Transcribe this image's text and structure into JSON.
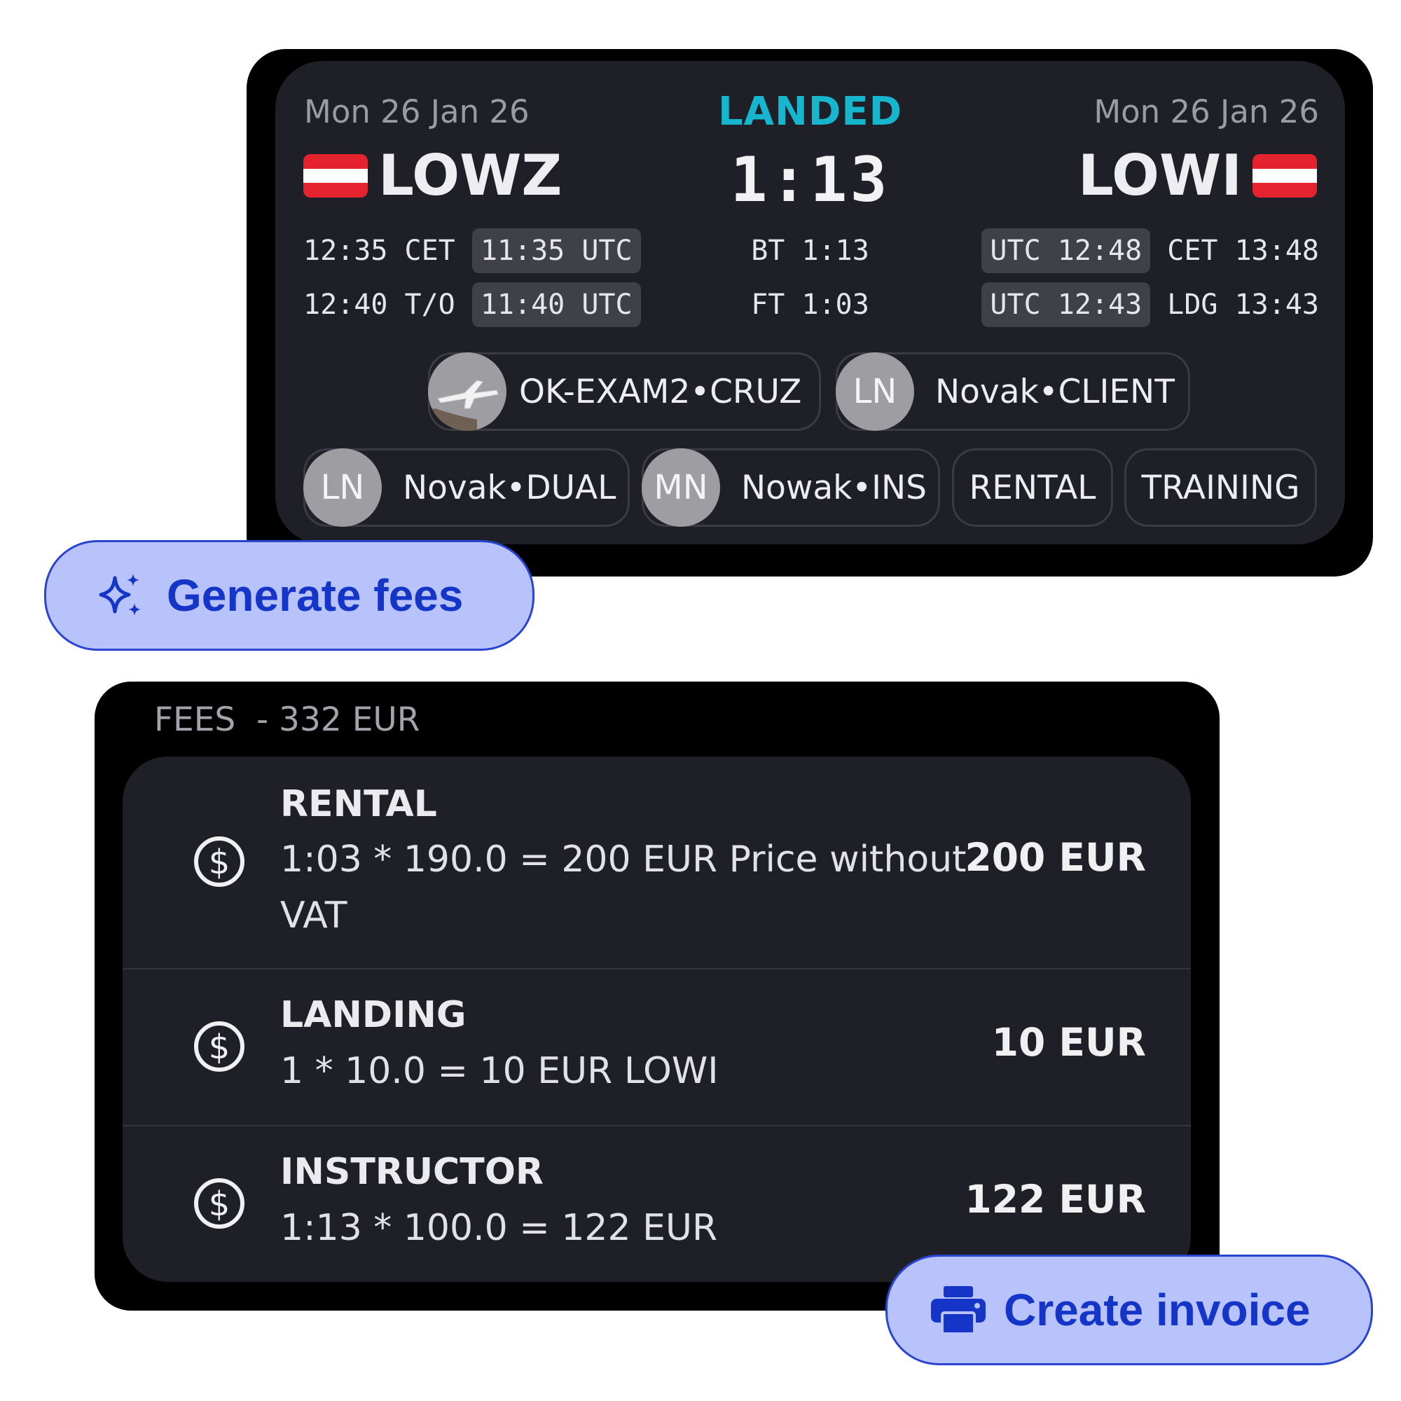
{
  "flight": {
    "departure": {
      "date": "Mon 26 Jan 26",
      "code": "LOWZ",
      "local_time": "12:35 CET",
      "utc_time": "11:35 UTC",
      "takeoff_local": "12:40 T/O",
      "takeoff_utc": "11:40 UTC"
    },
    "arrival": {
      "date": "Mon 26 Jan 26",
      "code": "LOWI",
      "utc_time": "UTC 12:48",
      "local_time": "CET 13:48",
      "landing_utc": "UTC 12:43",
      "landing_local": "LDG 13:43"
    },
    "status": "LANDED",
    "duration": "1:13",
    "block_time": "BT 1:13",
    "flight_time": "FT 1:03",
    "chips": {
      "aircraft": "OK-EXAM2•CRUZ",
      "client": {
        "initials": "LN",
        "label": "Novak•CLIENT"
      },
      "dual": {
        "initials": "LN",
        "label": "Novak•DUAL"
      },
      "instructor": {
        "initials": "MN",
        "label": "Nowak•INS"
      },
      "rental": "RENTAL",
      "training": "TRAINING"
    },
    "colors": {
      "status": "#17b6cf",
      "card": "#1e1f27",
      "flag_red": "#e5232f"
    }
  },
  "actions": {
    "generate_fees": "Generate fees",
    "create_invoice": "Create invoice",
    "icons": {
      "generate": "sparkles-icon",
      "invoice": "printer-icon"
    },
    "colors": {
      "bg": "#b8c2fb",
      "text": "#1535c8"
    }
  },
  "fees": {
    "title": "FEES  - 332 EUR",
    "items": [
      {
        "name": "RENTAL",
        "description": "1:03 * 190.0 = 200 EUR  Price without VAT",
        "amount": "200 EUR",
        "icon": "dollar-circle-icon"
      },
      {
        "name": "LANDING",
        "description": "1 * 10.0 = 10 EUR LOWI",
        "amount": "10 EUR",
        "icon": "dollar-circle-icon"
      },
      {
        "name": "INSTRUCTOR",
        "description": "1:13 * 100.0 = 122 EUR",
        "amount": "122 EUR",
        "icon": "dollar-circle-icon"
      }
    ]
  }
}
